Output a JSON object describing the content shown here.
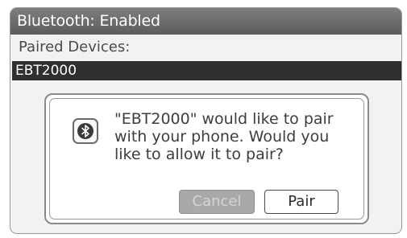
{
  "header": {
    "title": "Bluetooth: Enabled"
  },
  "paired": {
    "label": "Paired Devices:",
    "selected_device": "EBT2000"
  },
  "dialog": {
    "icon": "bluetooth-icon",
    "message_lines": [
      "\"EBT2000\" would like to pair",
      "with your phone. Would you",
      "like to allow it to pair?"
    ],
    "cancel_label": "Cancel",
    "pair_label": "Pair"
  }
}
